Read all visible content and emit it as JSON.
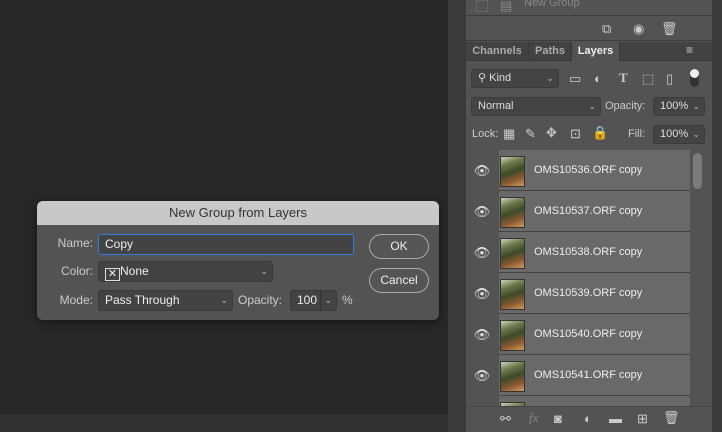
{
  "history": {
    "partial_item": "New Group"
  },
  "panel": {
    "tabs": [
      "Channels",
      "Paths",
      "Layers"
    ],
    "active_tab": "Layers",
    "filter": {
      "label": "Kind"
    },
    "blend_mode": "Normal",
    "opacity_label": "Opacity:",
    "opacity": "100%",
    "lock_label": "Lock:",
    "fill_label": "Fill:",
    "fill": "100%",
    "layers": [
      "OMS10536.ORF copy",
      "OMS10537.ORF copy",
      "OMS10538.ORF copy",
      "OMS10539.ORF copy",
      "OMS10540.ORF copy",
      "OMS10541.ORF copy"
    ]
  },
  "dialog": {
    "title": "New Group from Layers",
    "name_label": "Name:",
    "name_value": "Copy",
    "color_label": "Color:",
    "color_value": "None",
    "mode_label": "Mode:",
    "mode_value": "Pass Through",
    "opacity_label": "Opacity:",
    "opacity_value": "100",
    "percent": "%",
    "ok": "OK",
    "cancel": "Cancel"
  },
  "colors": {
    "focus": "#2f7fe0",
    "panel": "#535353",
    "canvas": "#282828"
  }
}
